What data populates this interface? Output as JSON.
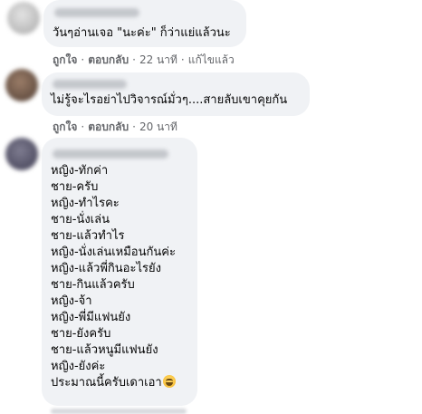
{
  "comments": [
    {
      "text_lines": [
        "วันๆอ่านเจอ \"นะค่ะ\" ก็ว่าแย่แล้วนะ"
      ],
      "actions": {
        "like": "ถูกใจ",
        "reply": "ตอบกลับ",
        "time": "22 นาที",
        "edited": "แก้ไขแล้ว"
      }
    },
    {
      "text_lines": [
        "ไม่รู้จะไรอย่าไปวิจารณ์มั่วๆ....สายลับเขาคุยกัน"
      ],
      "actions": {
        "like": "ถูกใจ",
        "reply": "ตอบกลับ",
        "time": "20 นาที"
      }
    },
    {
      "text_lines": [
        "หญิง-ทักค่า",
        "ชาย-ครับ",
        "หญิง-ทำไรคะ",
        "ชาย-นั่งเล่น",
        "ชาย-แล้วทำไร",
        "หญิง-นั่งเล่นเหมือนกันค่ะ",
        "หญิง-แล้วพี่กินอะไรยัง",
        "ชาย-กินแล้วครับ",
        "หญิง-จ้า",
        "หญิง-พี่มีแฟนยัง",
        "ชาย-ยังครับ",
        "ชาย-แล้วหนูมีแฟนยัง",
        "หญิง-ยังค่ะ",
        "ประมาณนี้ครับเดาเอา"
      ],
      "emoji": "grinning-sweat-face"
    }
  ],
  "separator": "·"
}
